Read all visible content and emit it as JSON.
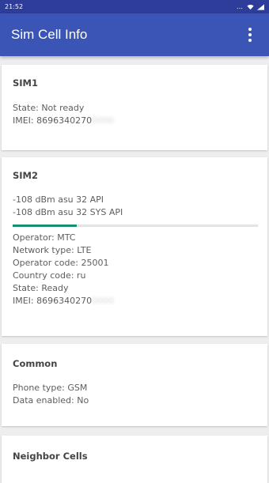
{
  "status_bar": {
    "time": "21:52",
    "icons": [
      "more-dots-icon",
      "wifi-icon",
      "signal-icon"
    ]
  },
  "app_bar": {
    "title": "Sim Cell Info",
    "menu_icon": "more-vert-icon"
  },
  "sim1": {
    "title": "SIM1",
    "state": "State: Not ready",
    "imei": "IMEI: 8696340270"
  },
  "sim2": {
    "title": "SIM2",
    "signal_api": "-108 dBm asu 32 API",
    "signal_sys_api": "-108 dBm asu 32 SYS API",
    "signal_level": 0.26,
    "accent_color": "#1a8f6f",
    "operator": "Operator: MTC",
    "network_type": "Network type: LTE",
    "operator_code": "Operator code: 25001",
    "country_code": "Country code: ru",
    "state": "State: Ready",
    "imei": "IMEI: 8696340270"
  },
  "common": {
    "title": "Common",
    "phone_type": "Phone type: GSM",
    "data_enabled": "Data enabled: No"
  },
  "neighbor": {
    "title": "Neighbor Cells"
  },
  "colors": {
    "app_bar": "#3a55b6",
    "status_bar": "#2d3d99",
    "background": "#eeeeee"
  }
}
